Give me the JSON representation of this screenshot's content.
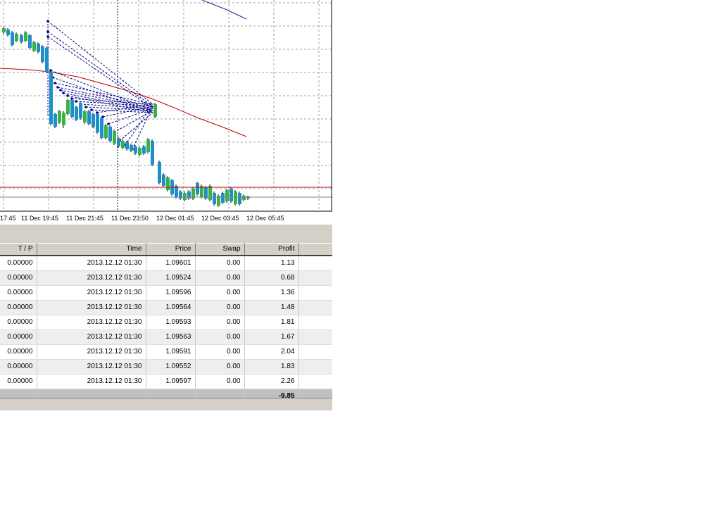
{
  "chart": {
    "time_labels": [
      "17:45",
      "11 Dec 19:45",
      "11 Dec 21:45",
      "11 Dec 23:50",
      "12 Dec 01:45",
      "12 Dec 03:45",
      "12 Dec 05:45"
    ],
    "colors": {
      "bull_candle": "#3cb043",
      "bear_candle": "#1e8fc8",
      "moving_average_red": "#c00000",
      "moving_average_blue": "#1a2a8c",
      "trade_lines": "#00008b",
      "grid": "#a0a0a0"
    }
  },
  "terminal": {
    "columns": [
      "T / P",
      "Time",
      "Price",
      "Swap",
      "Profit",
      ""
    ],
    "rows": [
      {
        "tp": "0.00000",
        "time": "2013.12.12 01:30",
        "price": "1.09601",
        "swap": "0.00",
        "profit": "1.13"
      },
      {
        "tp": "0.00000",
        "time": "2013.12.12 01:30",
        "price": "1.09524",
        "swap": "0.00",
        "profit": "0.68"
      },
      {
        "tp": "0.00000",
        "time": "2013.12.12 01:30",
        "price": "1.09596",
        "swap": "0.00",
        "profit": "1.36"
      },
      {
        "tp": "0.00000",
        "time": "2013.12.12 01:30",
        "price": "1.09564",
        "swap": "0.00",
        "profit": "1.48"
      },
      {
        "tp": "0.00000",
        "time": "2013.12.12 01:30",
        "price": "1.09593",
        "swap": "0.00",
        "profit": "1.81"
      },
      {
        "tp": "0.00000",
        "time": "2013.12.12 01:30",
        "price": "1.09563",
        "swap": "0.00",
        "profit": "1.67"
      },
      {
        "tp": "0.00000",
        "time": "2013.12.12 01:30",
        "price": "1.09591",
        "swap": "0.00",
        "profit": "2.04"
      },
      {
        "tp": "0.00000",
        "time": "2013.12.12 01:30",
        "price": "1.09552",
        "swap": "0.00",
        "profit": "1.83"
      },
      {
        "tp": "0.00000",
        "time": "2013.12.12 01:30",
        "price": "1.09597",
        "swap": "0.00",
        "profit": "2.26"
      }
    ],
    "total_profit": "-9.85"
  }
}
